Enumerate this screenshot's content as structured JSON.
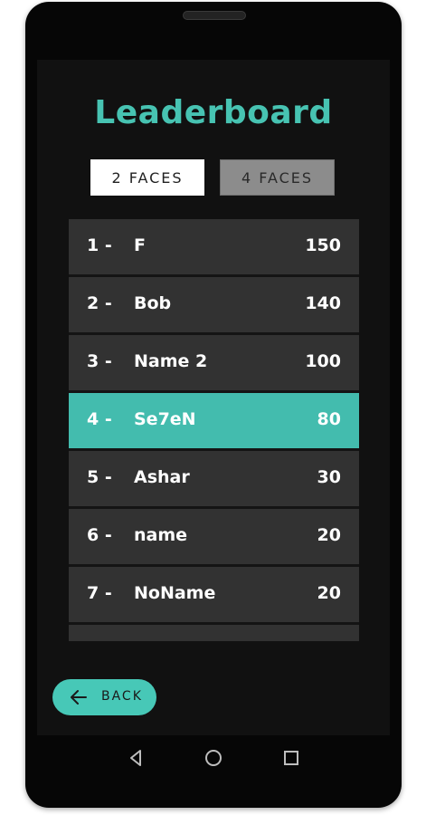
{
  "screen": {
    "title": "Leaderboard"
  },
  "tabs": [
    {
      "label": "2 FACES",
      "active": true
    },
    {
      "label": "4 FACES",
      "active": false
    }
  ],
  "leaderboard": {
    "rows": [
      {
        "rank": "1 -",
        "name": "F",
        "score": "150"
      },
      {
        "rank": "2 -",
        "name": "Bob",
        "score": "140"
      },
      {
        "rank": "3 -",
        "name": "Name 2",
        "score": "100"
      },
      {
        "rank": "4 -",
        "name": "Se7eN",
        "score": "80",
        "highlighted": true
      },
      {
        "rank": "5 -",
        "name": "Ashar",
        "score": "30"
      },
      {
        "rank": "6 -",
        "name": "name",
        "score": "20"
      },
      {
        "rank": "7 -",
        "name": "NoName",
        "score": "20"
      }
    ]
  },
  "back_button": {
    "label": "BACK",
    "icon": "arrow-left-icon"
  },
  "nav_bar": {
    "icons": [
      "back-triangle-icon",
      "home-circle-icon",
      "recents-square-icon"
    ]
  },
  "colors": {
    "accent": "#47c3b2",
    "highlight_row": "#43bcae",
    "row": "#323232",
    "screen_bg": "#111111"
  }
}
